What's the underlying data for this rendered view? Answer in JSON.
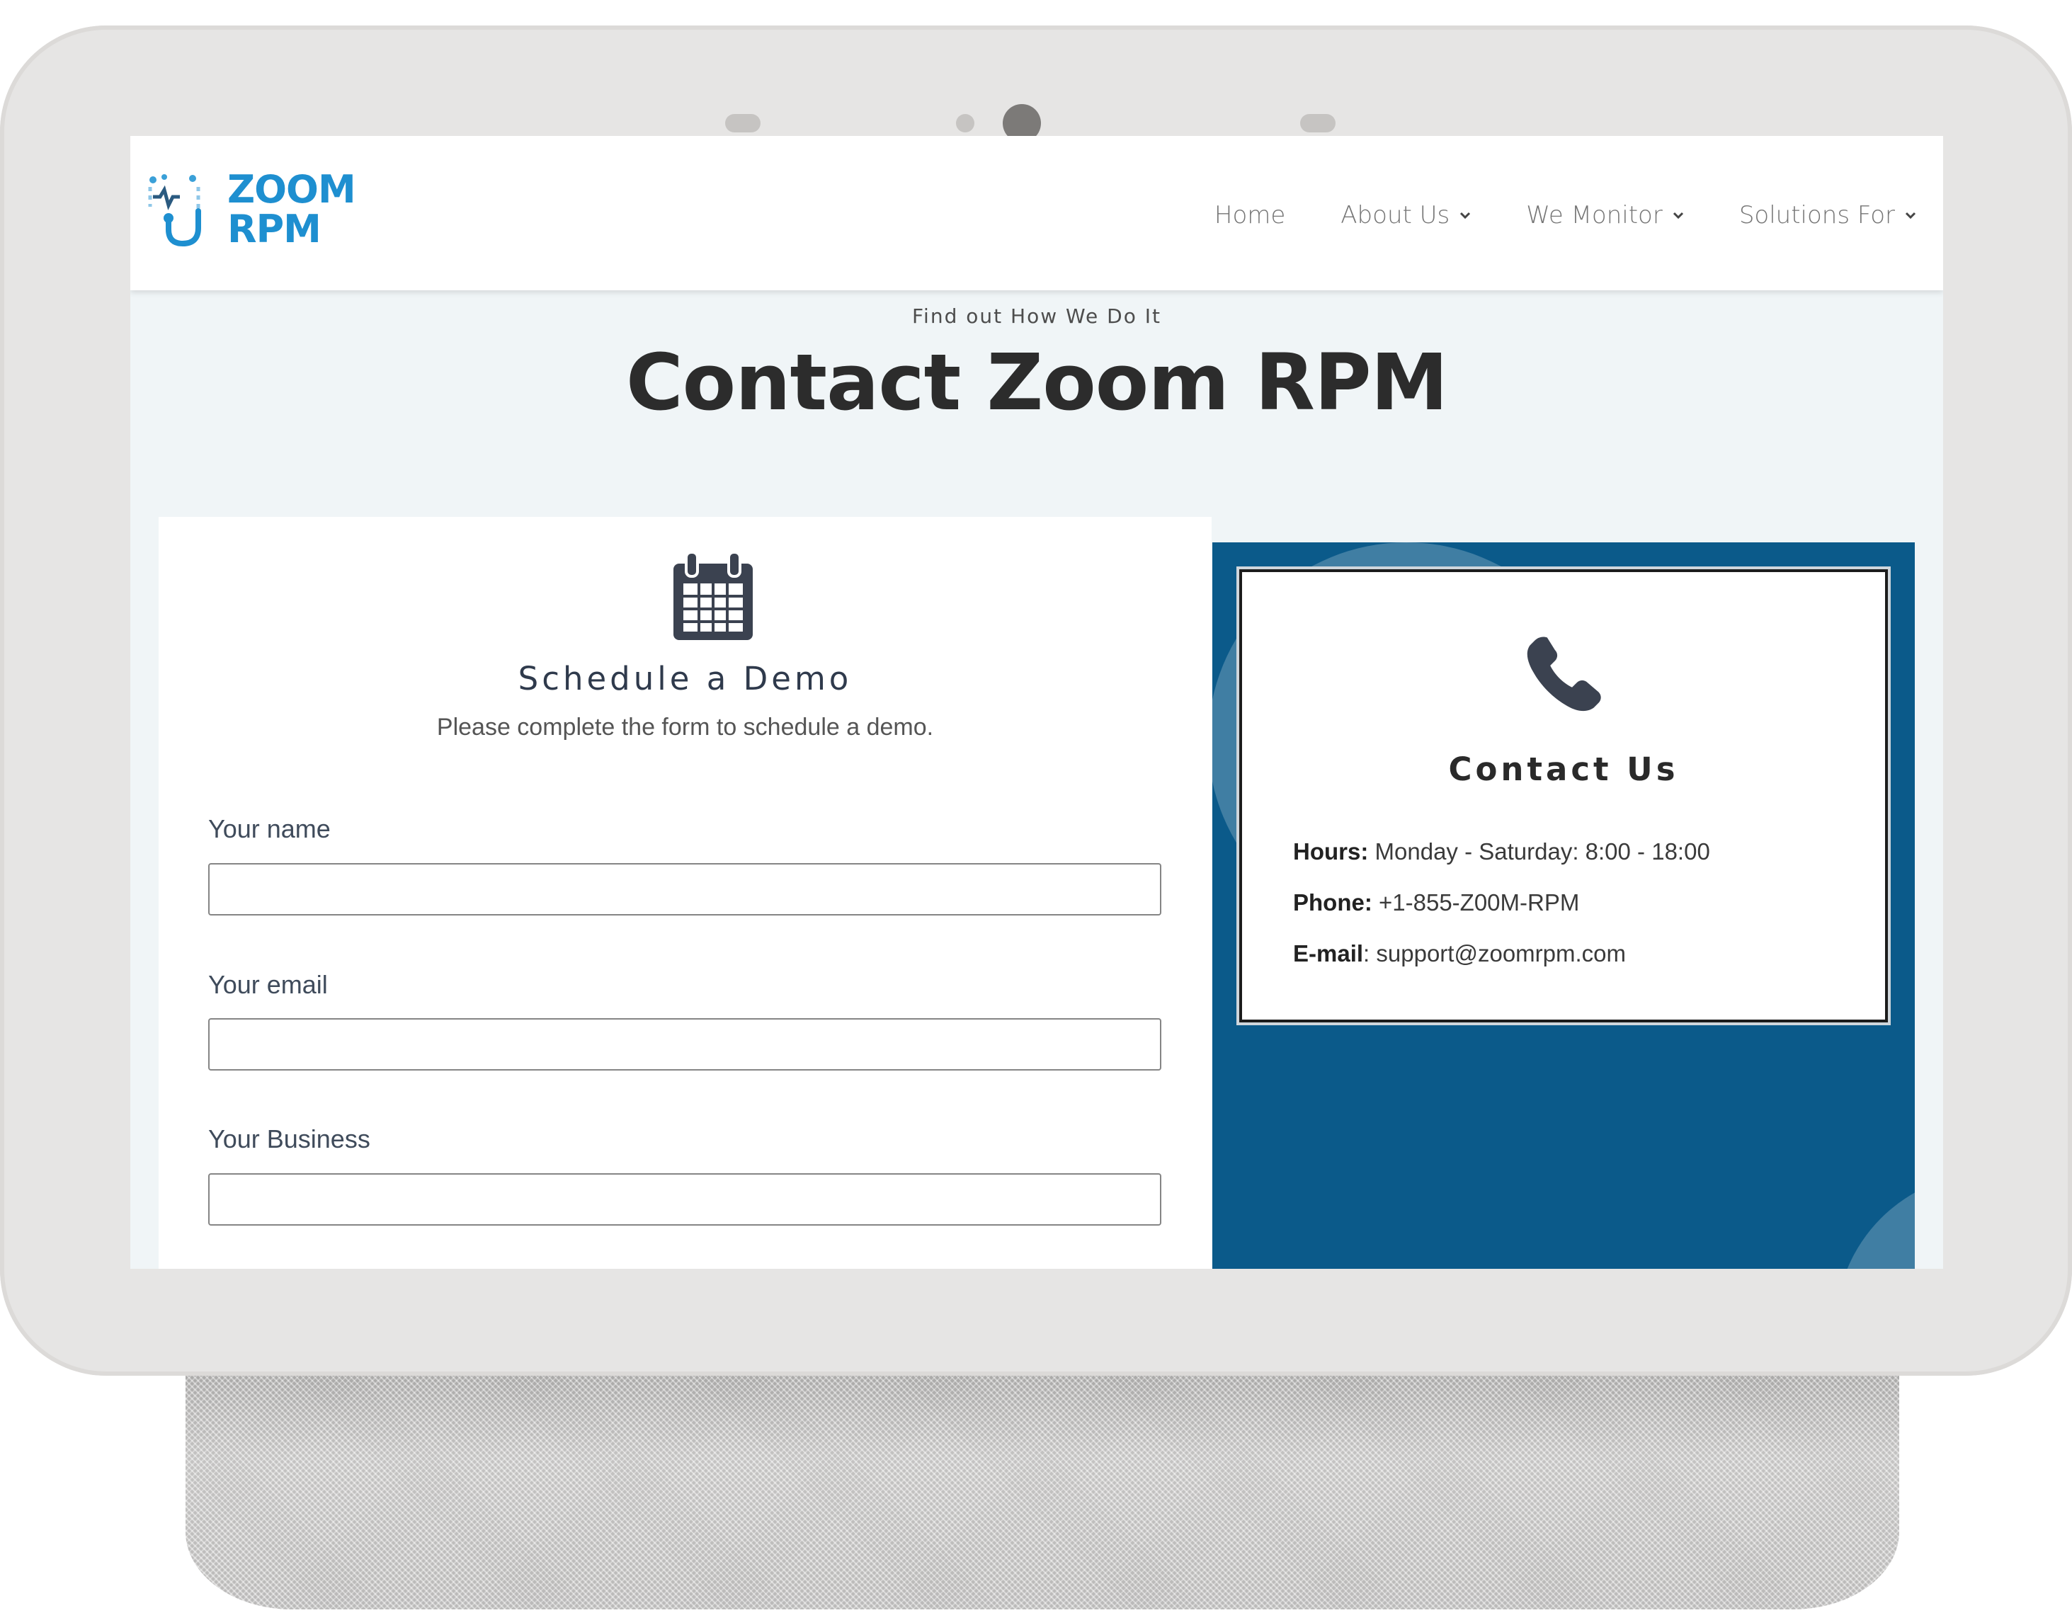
{
  "site": {
    "logo_text_line1": "ZOOM",
    "logo_text_line2": "RPM",
    "brand_color": "#1e8fd0"
  },
  "nav": {
    "items": [
      {
        "label": "Home",
        "has_dropdown": false
      },
      {
        "label": "About Us",
        "has_dropdown": true
      },
      {
        "label": "We Monitor",
        "has_dropdown": true
      },
      {
        "label": "Solutions For",
        "has_dropdown": true
      }
    ]
  },
  "hero": {
    "eyebrow": "Find out How We Do It",
    "title": "Contact Zoom RPM"
  },
  "form": {
    "icon": "calendar-icon",
    "title": "Schedule a Demo",
    "subtitle": "Please complete the form to schedule a demo.",
    "fields": [
      {
        "label": "Your name",
        "value": ""
      },
      {
        "label": "Your email",
        "value": ""
      },
      {
        "label": "Your Business",
        "value": ""
      }
    ]
  },
  "contact": {
    "icon": "phone-icon",
    "title": "Contact Us",
    "hours_label": "Hours:",
    "hours_value": "Monday - Saturday: 8:00 - 18:00",
    "phone_label": "Phone:",
    "phone_value": "+1-855-Z00M-RPM",
    "email_label": "E-mail",
    "email_sep": ":",
    "email_value": "support@zoomrpm.com",
    "panel_color": "#0b5a8a"
  }
}
